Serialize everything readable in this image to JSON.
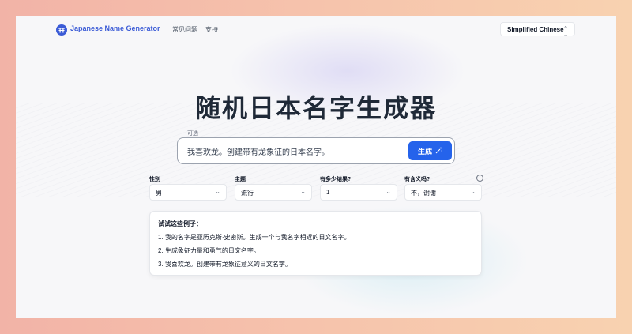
{
  "header": {
    "app_name": "Japanese Name Generator",
    "nav": [
      {
        "label": "常见问题"
      },
      {
        "label": "支持"
      }
    ],
    "language": "Simplified Chinese"
  },
  "main": {
    "title": "随机日本名字生成器",
    "optional_label": "可选",
    "prompt_value": "我喜欢龙。创建带有龙象征的日本名字。",
    "generate_label": "生成"
  },
  "filters": [
    {
      "label": "性别",
      "value": "男"
    },
    {
      "label": "主题",
      "value": "流行"
    },
    {
      "label": "有多少结果?",
      "value": "1"
    },
    {
      "label": "有含义吗?",
      "value": "不，谢谢"
    }
  ],
  "examples": {
    "title": "试试这些例子：",
    "items": [
      "1. 我的名字是亚历克斯·史密斯。生成一个与我名字相近的日文名字。",
      "2. 生成象征力量和勇气的日文名字。",
      "3. 我喜欢龙。创建带有龙象征意义的日文名字。"
    ]
  },
  "colors": {
    "accent": "#2563eb",
    "brand": "#3b5bd6"
  }
}
